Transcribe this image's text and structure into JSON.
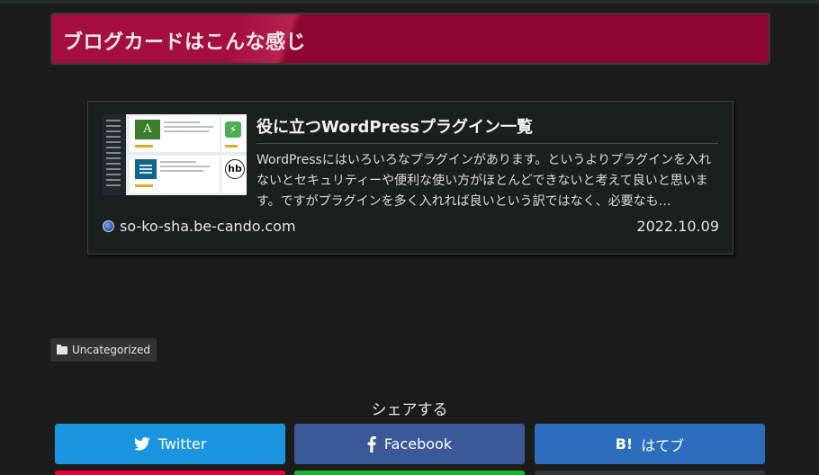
{
  "heading": {
    "text": "ブログカードはこんな感じ"
  },
  "blogcard": {
    "title": "役に立つWordPressプラグイン一覧",
    "snippet": "WordPressにはいろいろなプラグインがあります。というよりプラグインを入れないとセキュリティーや便利な使い方がほとんどできないと考えて良いと思います。ですがプラグインを多く入れれば良いという訳ではなく、必要なも…",
    "site": "so-ko-sha.be-cando.com",
    "date": "2022.10.09"
  },
  "category": {
    "label": "Uncategorized",
    "icon": "folder-icon"
  },
  "share": {
    "heading": "シェアする",
    "buttons": [
      {
        "label": "Twitter",
        "icon": "twitter-icon",
        "color": "#1b95e0"
      },
      {
        "label": "Facebook",
        "icon": "facebook-icon",
        "color": "#3b5998"
      },
      {
        "label": "はてブ",
        "icon": "hatena-bookmark-icon",
        "color": "#2c6ebd"
      }
    ]
  },
  "colors": {
    "background": "#1c1c1c",
    "heading_accent": "#a40f3f",
    "card_background": "#1a201e"
  }
}
